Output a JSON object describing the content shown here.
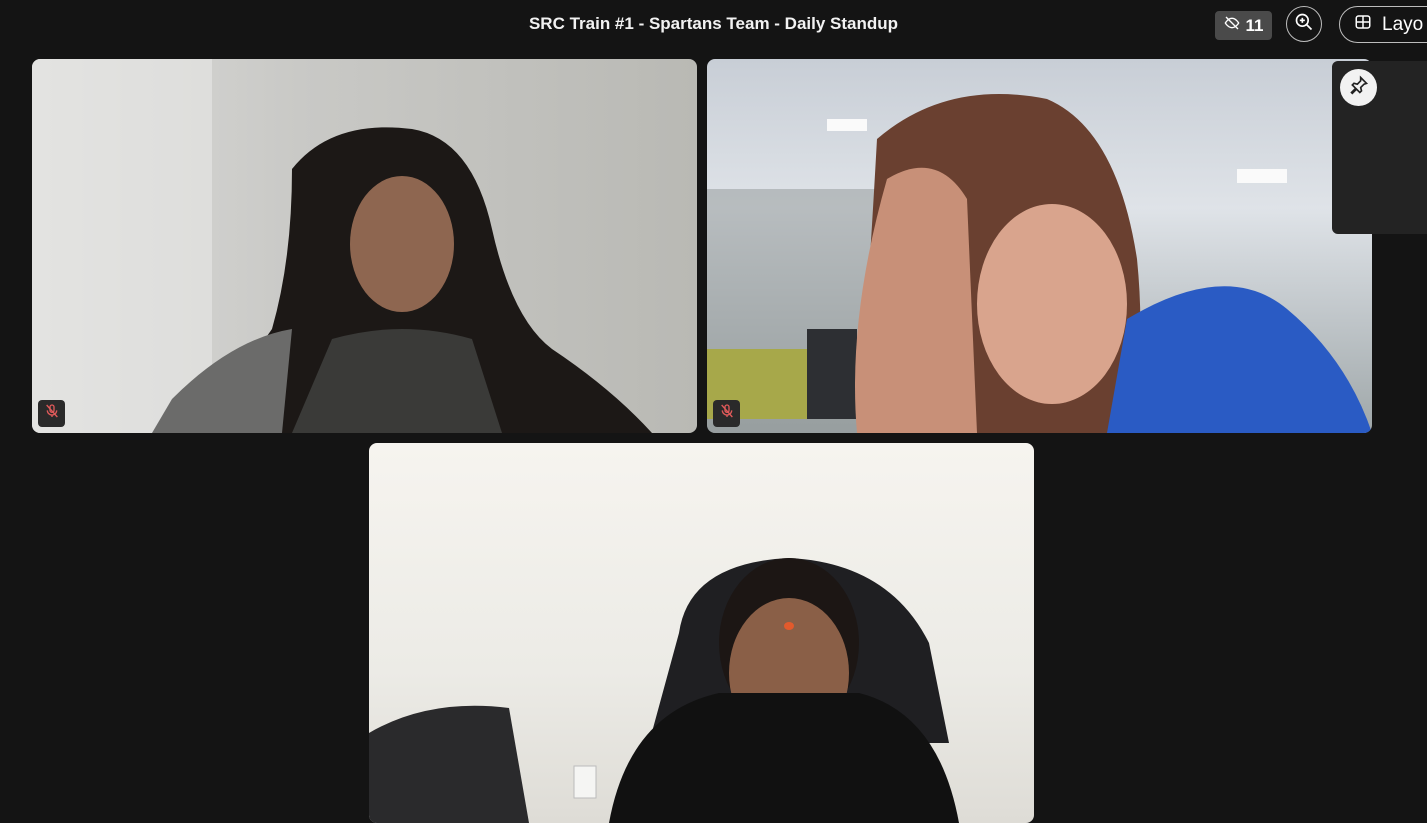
{
  "meeting": {
    "title": "SRC Train #1 - Spartans Team - Daily Standup"
  },
  "toolbar": {
    "hidden_count": "11",
    "layout_label": "Layo"
  },
  "participants": [
    {
      "id": "p1",
      "muted": true
    },
    {
      "id": "p2",
      "muted": true
    },
    {
      "id": "p3",
      "muted": false
    }
  ],
  "colors": {
    "background": "#141414",
    "muted_icon": "#e05a5a"
  }
}
